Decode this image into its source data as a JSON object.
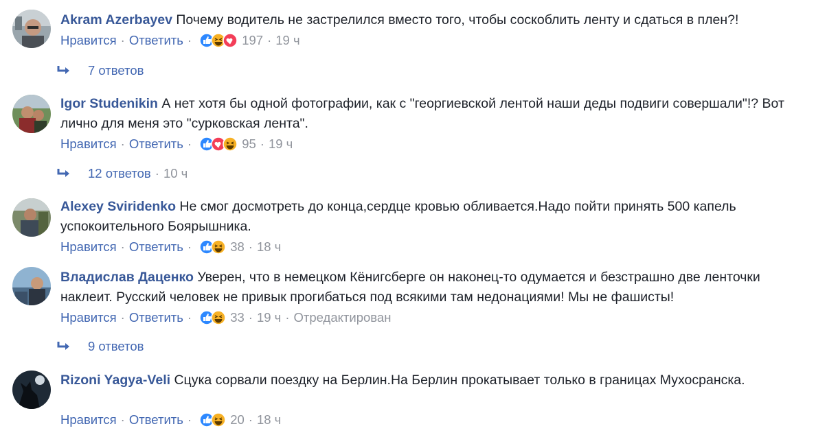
{
  "labels": {
    "like": "Нравится",
    "reply": "Ответить",
    "edited": "Отредактирован"
  },
  "comments": [
    {
      "author": "Akram Azerbayev",
      "text": "Почему водитель не застрелился вместо того, чтобы соскоблить ленту и сдаться в плен?!",
      "reactions": [
        "like",
        "haha",
        "love"
      ],
      "count": "197",
      "time": "19 ч",
      "replies": {
        "label": "7 ответов",
        "time": ""
      }
    },
    {
      "author": "Igor Studenikin",
      "text": "А нет хотя бы одной фотографии, как с \"георгиевской лентой наши деды подвиги совершали\"!? Вот лично для меня это \"сурковская лента\".",
      "reactions": [
        "like",
        "love",
        "haha"
      ],
      "count": "95",
      "time": "19 ч",
      "replies": {
        "label": "12 ответов",
        "time": "10 ч"
      }
    },
    {
      "author": "Alexey Sviridenko",
      "text": "Не смог досмотреть до конца,сердце кровью обливается.Надо пойти принять 500 капель успокоительного Боярышника.",
      "reactions": [
        "like",
        "haha"
      ],
      "count": "38",
      "time": "18 ч"
    },
    {
      "author": "Владислав Даценко",
      "text": "Уверен, что в немецком Кёнигсберге он наконец-то одумается и безстрашно две ленточки наклеит. Русский человек не привык прогибаться под всякими там недонациями! Мы не фашисты!",
      "reactions": [
        "like",
        "haha"
      ],
      "count": "33",
      "time": "19 ч",
      "edited": true,
      "replies": {
        "label": "9 ответов",
        "time": ""
      }
    },
    {
      "author": "Rizoni Yagya-Veli",
      "text": "Сцука сорвали поездку на Берлин.На Берлин прокатывает только в границах Мухосранска.",
      "reactions": [
        "like",
        "haha"
      ],
      "count": "20",
      "time": "18 ч"
    }
  ],
  "colors": {
    "author": "#385898",
    "link": "#4267b2",
    "meta": "#90949c",
    "like": "#2d88ff",
    "love": "#f33e58",
    "haha": "#f7b125"
  }
}
